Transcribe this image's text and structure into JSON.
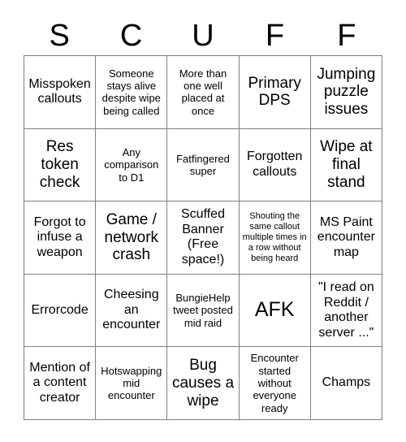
{
  "card": {
    "title_letters": [
      "S",
      "C",
      "U",
      "F",
      "F"
    ],
    "columns": 5,
    "rows": 5,
    "grid_line_color": "#808080",
    "text_color": "#000000",
    "background_color": "#ffffff",
    "cells": [
      {
        "text": "Misspoken callouts",
        "size": "s-md"
      },
      {
        "text": "Someone stays alive despite wipe being called",
        "size": "s-sm"
      },
      {
        "text": "More than one well placed at once",
        "size": "s-sm"
      },
      {
        "text": "Primary DPS",
        "size": "s-lg"
      },
      {
        "text": "Jumping puzzle issues",
        "size": "s-lg"
      },
      {
        "text": "Res token check",
        "size": "s-lg"
      },
      {
        "text": "Any comparison to D1",
        "size": "s-sm"
      },
      {
        "text": "Fatfingered super",
        "size": "s-sm"
      },
      {
        "text": "Forgotten callouts",
        "size": "s-md"
      },
      {
        "text": "Wipe at final stand",
        "size": "s-lg"
      },
      {
        "text": "Forgot to infuse a weapon",
        "size": "s-md"
      },
      {
        "text": "Game / network crash",
        "size": "s-lg"
      },
      {
        "text": "Scuffed Banner (Free space!)",
        "size": "s-md"
      },
      {
        "text": "Shouting the same callout multiple times in a row without being heard",
        "size": "s-xs"
      },
      {
        "text": "MS Paint encounter map",
        "size": "s-md"
      },
      {
        "text": "Errorcode",
        "size": "s-md"
      },
      {
        "text": "Cheesing an encounter",
        "size": "s-md"
      },
      {
        "text": "BungieHelp tweet posted mid raid",
        "size": "s-sm"
      },
      {
        "text": "AFK",
        "size": "s-xl"
      },
      {
        "text": "\"I read on Reddit / another server ...\"",
        "size": "s-md"
      },
      {
        "text": "Mention of a content creator",
        "size": "s-md"
      },
      {
        "text": "Hotswapping mid encounter",
        "size": "s-sm"
      },
      {
        "text": "Bug causes a wipe",
        "size": "s-lg"
      },
      {
        "text": "Encounter started without everyone ready",
        "size": "s-sm"
      },
      {
        "text": "Champs",
        "size": "s-md"
      }
    ]
  }
}
